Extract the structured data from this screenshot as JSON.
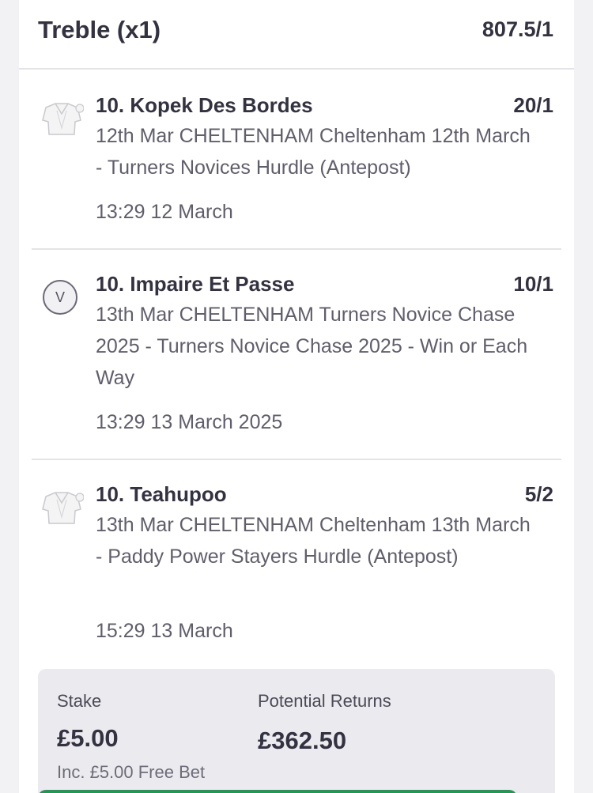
{
  "bet": {
    "title": "Treble (x1)",
    "odds": "807.5/1"
  },
  "legs": [
    {
      "icon": "silks-icon",
      "name": "10. Kopek Des Bordes",
      "odds": "20/1",
      "event": "12th Mar CHELTENHAM Cheltenham 12th March - Turners Novices Hurdle (Antepost)",
      "time": "13:29 12 March"
    },
    {
      "icon": "v-badge-icon",
      "badge": "V",
      "name": "10. Impaire Et Passe",
      "odds": "10/1",
      "event": "13th Mar CHELTENHAM Turners Novice Chase 2025 - Turners Novice Chase 2025 - Win or Each Way",
      "time": "13:29 13 March 2025"
    },
    {
      "icon": "silks-icon",
      "name": "10. Teahupoo",
      "odds": "5/2",
      "event": "13th Mar CHELTENHAM Cheltenham 13th March - Paddy Power Stayers Hurdle (Antepost)",
      "time": "15:29 13 March"
    }
  ],
  "summary": {
    "stake_label": "Stake",
    "stake_value": "£5.00",
    "returns_label": "Potential Returns",
    "returns_value": "£362.50",
    "free_bet_note": "Inc. £5.00 Free Bet"
  },
  "colors": {
    "accent": "#1e9a54",
    "text": "#333240",
    "muted": "#5f5e6b"
  }
}
